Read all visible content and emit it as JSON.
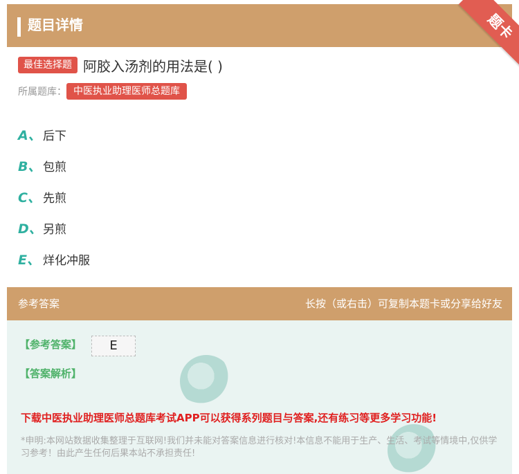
{
  "header": {
    "title": "题目详情",
    "ribbon": "题卡"
  },
  "question": {
    "type_badge": "最佳选择题",
    "text": "阿胶入汤剂的用法是( )",
    "bank_label": "所属题库：",
    "bank_name": "中医执业助理医师总题库"
  },
  "options": [
    {
      "letter": "A、",
      "text": "后下"
    },
    {
      "letter": "B、",
      "text": "包煎"
    },
    {
      "letter": "C、",
      "text": "先煎"
    },
    {
      "letter": "D、",
      "text": "另煎"
    },
    {
      "letter": "E、",
      "text": "烊化冲服"
    }
  ],
  "answer_section": {
    "title": "参考答案",
    "hint": "长按（或右击）可复制本题卡或分享给好友",
    "answer_label": "【参考答案】",
    "answer_value": "E",
    "analysis_label": "【答案解析】",
    "promo": "下载中医执业助理医师总题库考试APP可以获得系列题目与答案,还有练习等更多学习功能!",
    "disclaimer": "*申明:本网站数据收集整理于互联网!我们并未能对答案信息进行核对!本信息不能用于生产、生活、考试等情境中,仅供学习参考！由此产生任何后果本站不承担责任!"
  },
  "colors": {
    "header_bg": "#cf9f6c",
    "badge_red": "#e05349",
    "option_letter": "#2fb0a0",
    "answer_green": "#4fb26a",
    "promo_red": "#e02020"
  }
}
